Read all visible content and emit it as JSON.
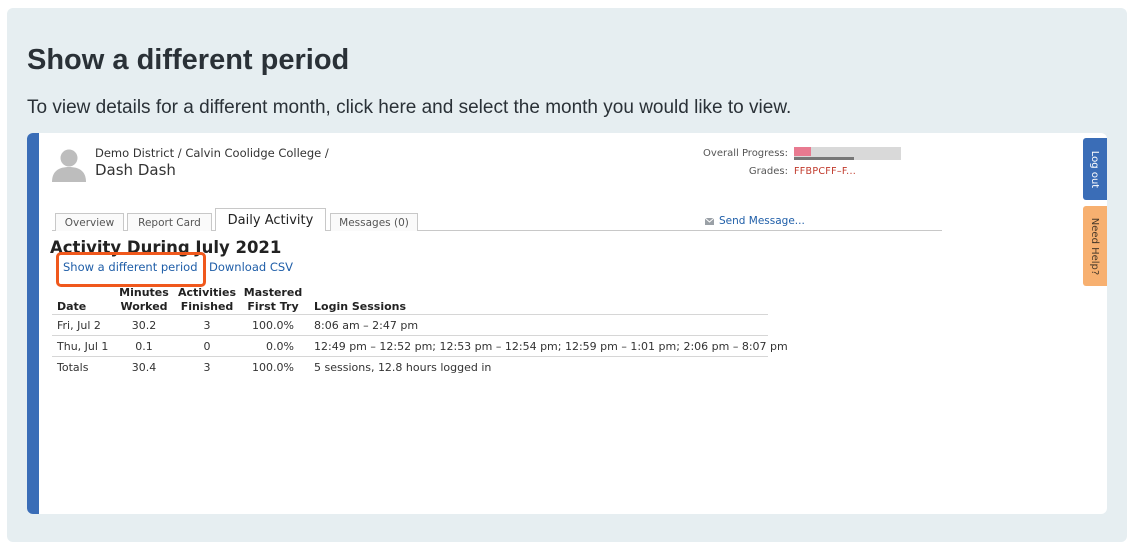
{
  "card": {
    "title": "Show a different period",
    "description": "To view details for a different month, click here and select the month you would like to view."
  },
  "student": {
    "org_path": "Demo District / Calvin Coolidge College /",
    "name": "Dash Dash"
  },
  "progress": {
    "label": "Overall Progress:",
    "value_fraction": 0.16,
    "grades_label": "Grades:",
    "grades_value": "FFBPCFF–F..."
  },
  "tabs": [
    {
      "label": "Overview",
      "active": false
    },
    {
      "label": "Report Card",
      "active": false
    },
    {
      "label": "Daily Activity",
      "active": true
    },
    {
      "label": "Messages (0)",
      "active": false
    }
  ],
  "send_message": "Send Message...",
  "activity": {
    "title": "Activity During July 2021",
    "show_period_link": "Show a different period",
    "download_csv_link": "Download CSV"
  },
  "table": {
    "headers": {
      "date": "Date",
      "minutes_1": "Minutes",
      "minutes_2": "Worked",
      "activities_1": "Activities",
      "activities_2": "Finished",
      "mastered_1": "Mastered",
      "mastered_2": "First Try",
      "login": "Login Sessions"
    },
    "rows": [
      {
        "date": "Fri, Jul 2",
        "minutes": "30.2",
        "activities": "3",
        "mastered": "100.0%",
        "login": "8:06 am – 2:47 pm"
      },
      {
        "date": "Thu, Jul 1",
        "minutes": "0.1",
        "activities": "0",
        "mastered": "0.0%",
        "login": "12:49 pm – 12:52 pm; 12:53 pm – 12:54 pm; 12:59 pm – 1:01 pm; 2:06 pm – 8:07 pm"
      },
      {
        "date": "Totals",
        "minutes": "30.4",
        "activities": "3",
        "mastered": "100.0%",
        "login": "5 sessions, 12.8 hours logged in"
      }
    ]
  },
  "side_buttons": {
    "logout": "Log out",
    "help": "Need Help?"
  },
  "colors": {
    "accent_blue": "#3a6db7",
    "link_blue": "#1f5ea8",
    "highlight_orange": "#f0581c",
    "help_orange": "#f7b070",
    "progress_pink": "#e87a90"
  }
}
